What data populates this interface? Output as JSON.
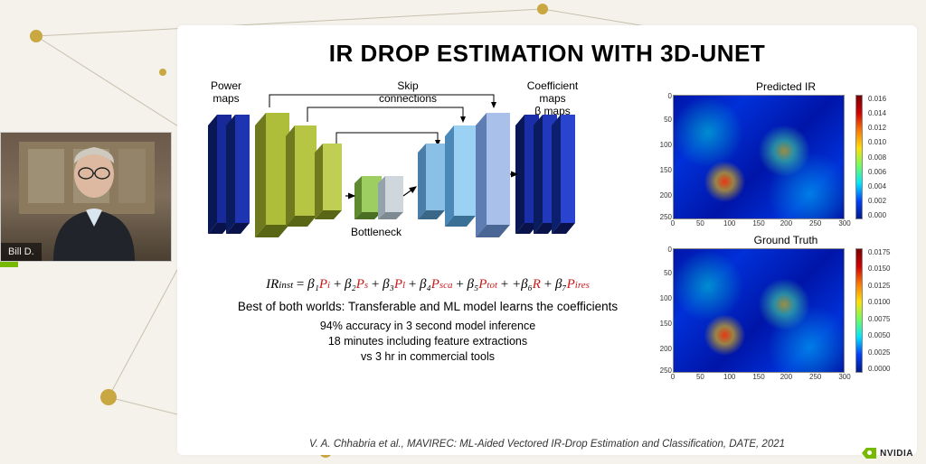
{
  "speaker": {
    "name": "Bill D."
  },
  "title": "IR DROP ESTIMATION WITH 3D-UNET",
  "diagram_labels": {
    "power_maps": "Power\nmaps",
    "bottleneck": "Bottleneck",
    "skip": "Skip\nconnections",
    "coeff_maps": "Coefficient\nmaps\nβ maps"
  },
  "equation": {
    "lhs": "IR",
    "lhs_sub": "inst",
    "terms": [
      {
        "b": "β₁",
        "p": "P",
        "psub": "i"
      },
      {
        "b": "β₂",
        "p": "P",
        "psub": "s"
      },
      {
        "b": "β₃",
        "p": "P",
        "psub": "l"
      },
      {
        "b": "β₄",
        "p": "P",
        "psub": "sca"
      },
      {
        "b": "β₅",
        "p": "P",
        "psub": "tot"
      },
      {
        "b": "+β₆",
        "p": "R",
        "psub": ""
      },
      {
        "b": "β₇",
        "p": "P",
        "psub": "ires"
      }
    ]
  },
  "caption_main": "Best of both worlds: Transferable and ML model learns the coefficients",
  "bullets": [
    "94% accuracy in 3 second model inference",
    "18 minutes including feature extractions",
    "vs 3 hr in commercial tools"
  ],
  "citation": "V. A. Chhabria et al., MAVIREC: ML-Aided Vectored IR-Drop Estimation and Classification, DATE, 2021",
  "heatmaps": {
    "predicted": {
      "title": "Predicted IR",
      "yticks": [
        "0",
        "50",
        "100",
        "150",
        "200",
        "250"
      ],
      "xticks": [
        "0",
        "50",
        "100",
        "150",
        "200",
        "250",
        "300"
      ],
      "cticks": [
        "0.016",
        "0.014",
        "0.012",
        "0.010",
        "0.008",
        "0.006",
        "0.004",
        "0.002",
        "0.000"
      ]
    },
    "ground": {
      "title": "Ground Truth",
      "yticks": [
        "0",
        "50",
        "100",
        "150",
        "200",
        "250"
      ],
      "xticks": [
        "0",
        "50",
        "100",
        "150",
        "200",
        "250",
        "300"
      ],
      "cticks": [
        "0.0175",
        "0.0150",
        "0.0125",
        "0.0100",
        "0.0075",
        "0.0050",
        "0.0025",
        "0.0000"
      ]
    }
  },
  "logo_text": "NVIDIA",
  "chart_data": [
    {
      "type": "heatmap",
      "title": "Predicted IR",
      "xlabel": "",
      "ylabel": "",
      "xlim": [
        0,
        300
      ],
      "ylim": [
        0,
        250
      ],
      "colorbar_range": [
        0.0,
        0.016
      ],
      "note": "IR-drop map; hotspots near (90,175) and (200,120); background mostly ~0.002–0.006"
    },
    {
      "type": "heatmap",
      "title": "Ground Truth",
      "xlabel": "",
      "ylabel": "",
      "xlim": [
        0,
        300
      ],
      "ylim": [
        0,
        250
      ],
      "colorbar_range": [
        0.0,
        0.0175
      ],
      "note": "IR-drop map; similar hotspot pattern to Predicted IR"
    }
  ]
}
